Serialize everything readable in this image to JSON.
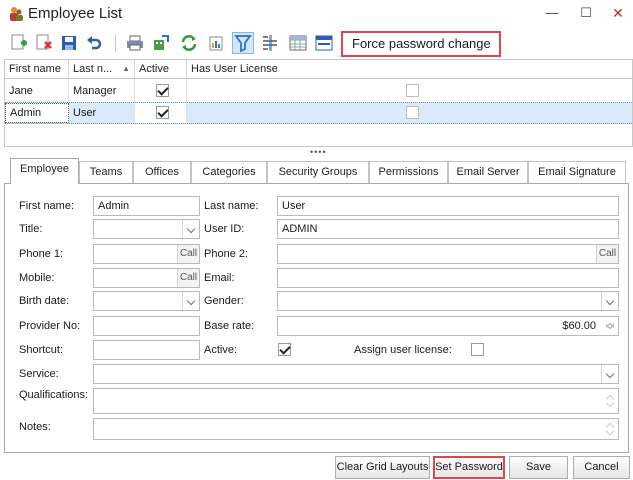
{
  "window": {
    "title": "Employee List",
    "minimize": "—",
    "maximize": "☐",
    "close": "✕"
  },
  "toolbar": {
    "items": [
      "add-icon",
      "delete-icon",
      "save-icon",
      "undo-icon",
      "print-icon",
      "export-icon",
      "refresh-icon",
      "import-icon",
      "filter-icon",
      "columns-icon",
      "grid-layout-icon",
      "panel-icon"
    ],
    "active_item": "filter-icon",
    "force_password_label": "Force password change"
  },
  "grid": {
    "columns": [
      "First name",
      "Last n...",
      "Active",
      "Has User License"
    ],
    "sort_arrow": "▲",
    "rows": [
      {
        "first": "Jane",
        "last": "Manager",
        "active": true,
        "license": false
      },
      {
        "first": "Admin",
        "last": "User",
        "active": true,
        "license": false
      }
    ],
    "splitter": "••••"
  },
  "tabs": [
    "Employee",
    "Teams",
    "Offices",
    "Categories",
    "Security Groups",
    "Permissions",
    "Email Server",
    "Email Signature"
  ],
  "selected_tab": "Employee",
  "form": {
    "first_name_label": "First name:",
    "first_name_value": "Admin",
    "last_name_label": "Last name:",
    "last_name_value": "User",
    "title_label": "Title:",
    "title_value": "",
    "user_id_label": "User ID:",
    "user_id_value": "ADMIN",
    "phone1_label": "Phone 1:",
    "phone2_label": "Phone 2:",
    "call_label": "Call",
    "mobile_label": "Mobile:",
    "email_label": "Email:",
    "birth_label": "Birth date:",
    "gender_label": "Gender:",
    "provider_label": "Provider No:",
    "base_rate_label": "Base rate:",
    "base_rate_value": "$60.00",
    "shortcut_label": "Shortcut:",
    "active_label": "Active:",
    "active_value": true,
    "assign_license_label": "Assign user license:",
    "assign_license_value": false,
    "service_label": "Service:",
    "qualifications_label": "Qualifications:",
    "notes_label": "Notes:"
  },
  "buttons": {
    "clear_grid": "Clear Grid Layouts",
    "set_password": "Set Password",
    "save": "Save",
    "cancel": "Cancel"
  },
  "colors": {
    "highlight_border": "#e0474a",
    "selected_row": "#dbeaf8",
    "accent_green": "#2e9b3c",
    "accent_blue": "#2a73c4"
  }
}
